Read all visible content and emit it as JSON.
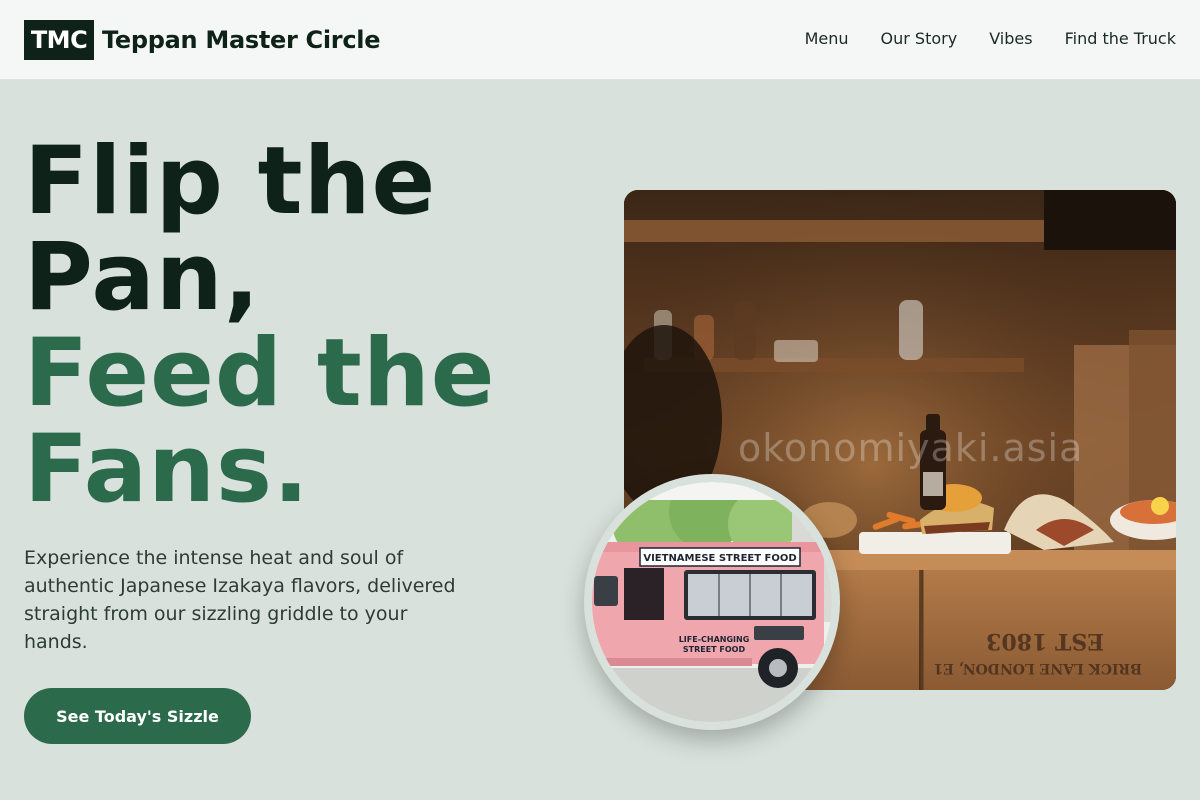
{
  "header": {
    "logo_text": "TMC",
    "brand_name": "Teppan Master Circle",
    "nav": [
      {
        "label": "Menu"
      },
      {
        "label": "Our Story"
      },
      {
        "label": "Vibes"
      },
      {
        "label": "Find the Truck"
      }
    ]
  },
  "hero": {
    "headline_line1": "Flip the",
    "headline_line2": "Pan,",
    "headline_line3": "Feed the",
    "headline_line4": "Fans.",
    "description": "Experience the intense heat and soul of authentic Japanese Izakaya flavors, delivered straight from our sizzling griddle to your hands.",
    "cta_label": "See Today's Sizzle"
  },
  "photos": {
    "main_watermark": "okonomiyaki.asia",
    "truck_header": "VIETNAMESE STREET FOOD",
    "truck_slogan_1": "LIFE-CHANGING",
    "truck_slogan_2": "STREET FOOD",
    "crate_text_1": "BRICK LANE LONDON, E1",
    "crate_text_2": "EST 1803"
  },
  "colors": {
    "background": "#d8e1dc",
    "header_bg": "#f5f7f6",
    "dark_text": "#0f2219",
    "accent_green": "#2c6a4c",
    "button_text": "#ffffff",
    "truck_pink": "#f0a6ad"
  }
}
